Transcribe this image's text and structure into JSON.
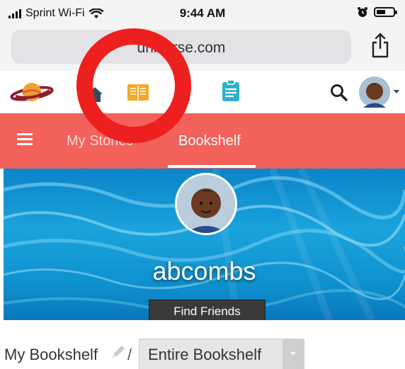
{
  "status_bar": {
    "carrier": "Sprint Wi-Fi",
    "time": "9:44 AM",
    "battery_level": 0.55
  },
  "browser": {
    "url": "universe.com"
  },
  "nav": {
    "icons": [
      "saturn-logo-icon",
      "home-icon",
      "book-icon",
      "document-icon",
      "clipboard-icon",
      "search-icon",
      "avatar"
    ],
    "accent_colors": {
      "book": "#f0a928",
      "clipboard": "#2eb0c8",
      "logo": "#e25a3c"
    }
  },
  "tabs": {
    "items": [
      {
        "label": "My Stories"
      },
      {
        "label": "Bookshelf"
      }
    ],
    "active_index": 1,
    "color": "#f2615a"
  },
  "profile": {
    "username": "abcombs",
    "find_friends": "Find Friends"
  },
  "bookshelf": {
    "title": "My Bookshelf",
    "separator": "/",
    "filter_value": "Entire Bookshelf"
  },
  "annotation": {
    "color": "#ee1f1f"
  }
}
